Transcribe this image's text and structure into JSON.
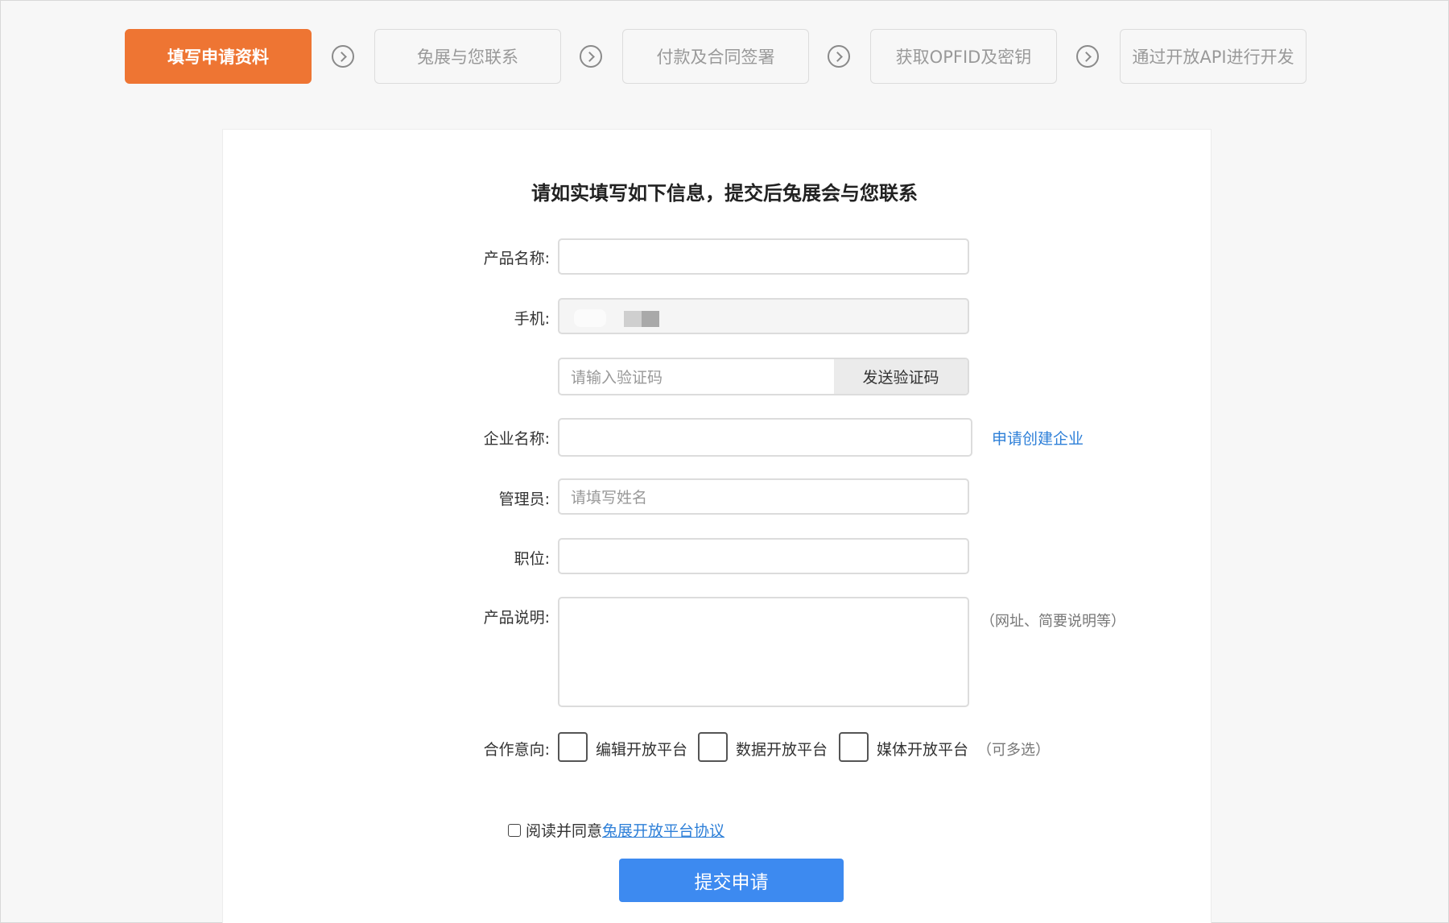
{
  "steps": [
    {
      "label": "填写申请资料",
      "active": true
    },
    {
      "label": "兔展与您联系",
      "active": false
    },
    {
      "label": "付款及合同签署",
      "active": false
    },
    {
      "label": "获取OPFID及密钥",
      "active": false
    },
    {
      "label": "通过开放API进行开发",
      "active": false
    }
  ],
  "form": {
    "title": "请如实填写如下信息，提交后兔展会与您联系",
    "product_name_label": "产品名称:",
    "phone_label": "手机:",
    "code_placeholder": "请输入验证码",
    "send_code_label": "发送验证码",
    "company_label": "企业名称:",
    "create_company_link": "申请创建企业",
    "admin_label": "管理员:",
    "admin_placeholder": "请填写姓名",
    "position_label": "职位:",
    "desc_label": "产品说明:",
    "desc_hint": "（网址、简要说明等）",
    "coop_label": "合作意向:",
    "coop_options": [
      "编辑开放平台",
      "数据开放平台",
      "媒体开放平台"
    ],
    "coop_hint": "（可多选）",
    "agree_text": "阅读并同意",
    "agree_link": "兔展开放平台协议",
    "submit_label": "提交申请"
  },
  "colors": {
    "accent": "#ee7533",
    "primary": "#3d8af0",
    "link": "#2d7fd8"
  }
}
